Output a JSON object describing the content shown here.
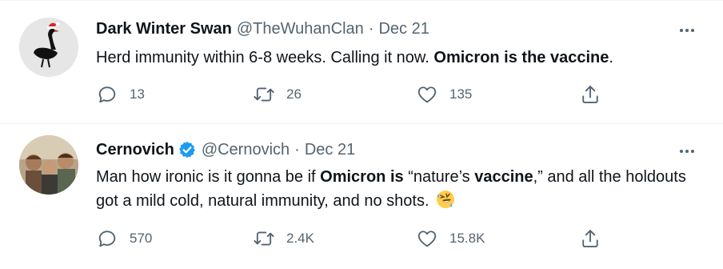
{
  "tweets": [
    {
      "display_name": "Dark Winter Swan",
      "handle": "@TheWuhanClan",
      "separator": "·",
      "date": "Dec 21",
      "verified": false,
      "text_plain": "Herd immunity within 6-8 weeks. Calling it now.  ",
      "text_bold": "Omicron is the vaccine",
      "text_end": ".",
      "replies": "13",
      "retweets": "26",
      "likes": "135",
      "avatar_icon": "black-swan-with-santa-hat"
    },
    {
      "display_name": "Cernovich",
      "handle": "@Cernovich",
      "separator": "·",
      "date": "Dec 21",
      "verified": true,
      "text_seg1": "Man how ironic is it gonna be if ",
      "text_bold1": "Omicron is",
      "text_seg2": " “nature’s ",
      "text_bold2": "vaccine",
      "text_seg3": ",” and all the holdouts got a mild cold, natural immunity, and no shots. ",
      "emoji": "rolling-on-floor-laughing",
      "replies": "570",
      "retweets": "2.4K",
      "likes": "15.8K",
      "avatar_icon": "group-photo"
    }
  ],
  "colors": {
    "text": "#0f1419",
    "secondary": "#536471",
    "verified": "#1d9bf0",
    "divider": "#eff3f4"
  }
}
